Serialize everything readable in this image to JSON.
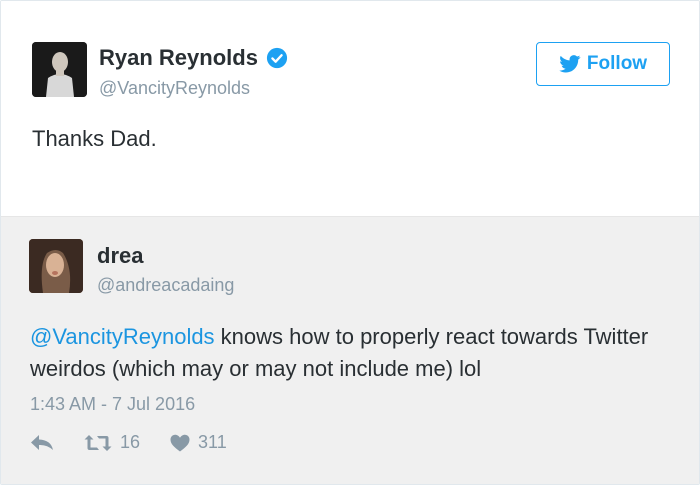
{
  "author": {
    "name": "Ryan Reynolds",
    "handle": "@VancityReynolds",
    "verified": true,
    "avatar_icon": "avatar-photo"
  },
  "follow_button": {
    "label": "Follow",
    "icon": "twitter-bird-icon"
  },
  "tweet": {
    "text": "Thanks Dad."
  },
  "quoted": {
    "name": "drea",
    "handle": "@andreacadaing",
    "mention": "@VancityReynolds",
    "text_rest": " knows how to properly react towards Twitter weirdos (which may or may not include me) lol",
    "time": "1:43 AM - 7 Jul 2016",
    "retweets": "16",
    "likes": "311"
  },
  "colors": {
    "accent": "#1da1f2",
    "mention": "#1b95e0",
    "muted": "#8899a6",
    "text": "#292f33",
    "quoted_bg": "#f0f0f0"
  }
}
